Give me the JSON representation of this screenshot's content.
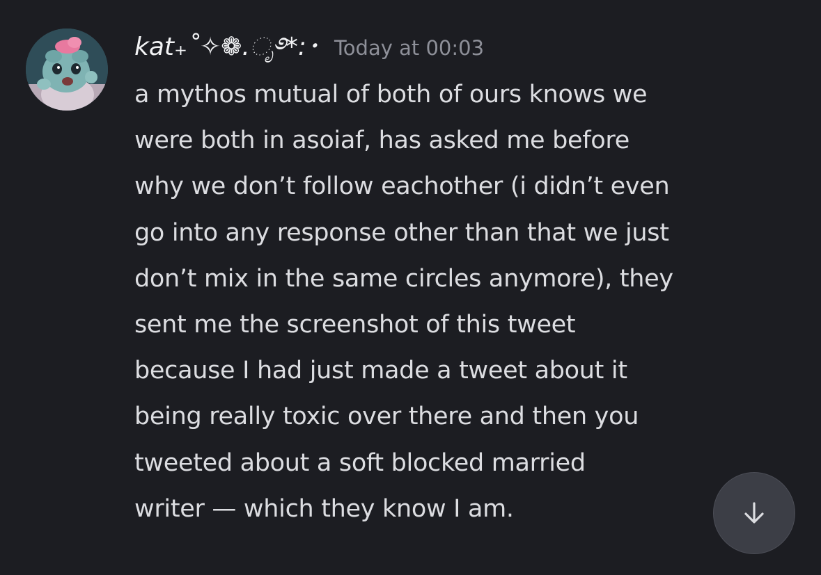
{
  "message": {
    "username": "kat₊˚✧❁.ೃ࿔*:･",
    "timestamp": "Today at 00:03",
    "lines": [
      "a mythos mutual of both of ours knows we",
      "were both in asoiaf, has asked me before",
      "why we don’t follow eachother (i didn’t even",
      "go into any response other than that we just",
      "don’t mix in the same circles anymore), they",
      "sent me the screenshot of this tweet",
      "because I had just made a tweet about it",
      "being really toxic over there and then you",
      "tweeted about a soft blocked married",
      "writer — which they know I am."
    ]
  },
  "icons": {
    "avatar": "avatar-cartoon-character",
    "jump": "arrow-down-icon"
  },
  "colors": {
    "background": "#1c1d22",
    "username": "#f2f3f5",
    "timestamp": "#8e9099",
    "text": "#dcdde1",
    "jump_button": "#3c3e46"
  }
}
